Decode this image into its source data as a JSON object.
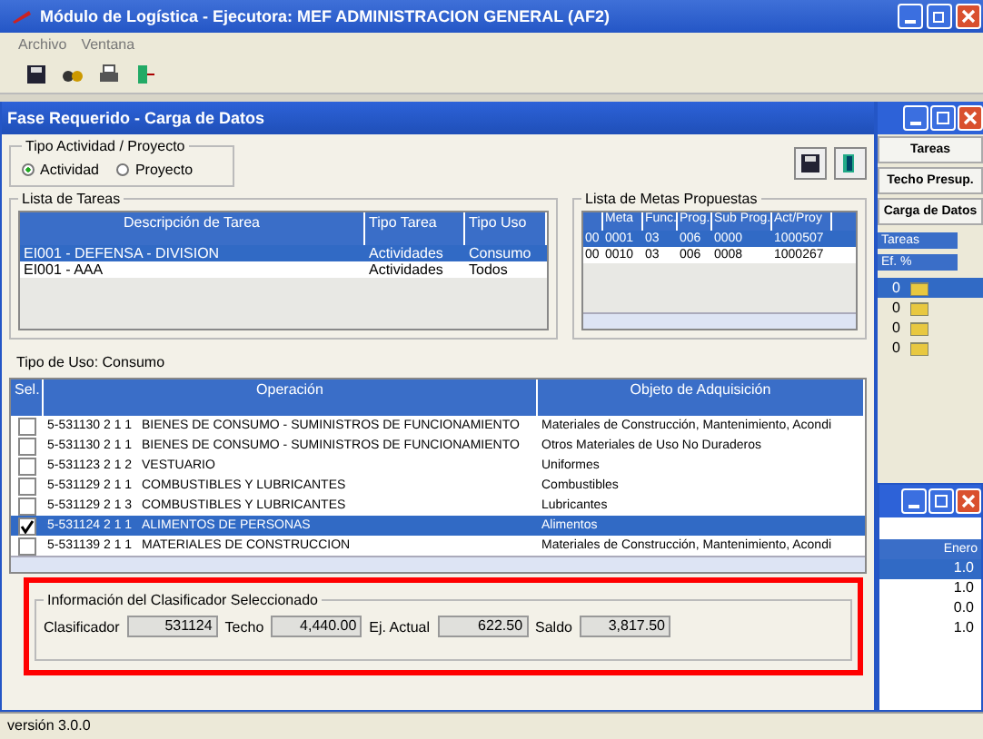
{
  "window": {
    "title": "Módulo de Logística - Ejecutora: MEF ADMINISTRACION GENERAL (AF2)"
  },
  "menu": [
    "Archivo",
    "Ventana"
  ],
  "dialog": {
    "title": "Fase Requerido - Carga de Datos",
    "tipo_group": {
      "title": "Tipo Actividad / Proyecto",
      "options": [
        {
          "label": "Actividad",
          "selected": true
        },
        {
          "label": "Proyecto",
          "selected": false
        }
      ]
    },
    "tareas": {
      "title": "Lista de Tareas",
      "columns": [
        "Descripción de Tarea",
        "Tipo Tarea",
        "Tipo Uso"
      ],
      "rows": [
        {
          "cells": [
            "EI001 - DEFENSA - DIVISION",
            "Actividades",
            "Consumo"
          ],
          "selected": true
        },
        {
          "cells": [
            "EI001 - AAA",
            "Actividades",
            "Todos"
          ],
          "selected": false
        }
      ]
    },
    "metas": {
      "title": "Lista de Metas Propuestas",
      "columns": [
        "",
        "Meta",
        "Func.",
        "Prog.",
        "Sub Prog.",
        "Act/Proy"
      ],
      "rows": [
        {
          "cells": [
            "00",
            "0001",
            "03",
            "006",
            "0000",
            "1000507"
          ],
          "selected": true
        },
        {
          "cells": [
            "00",
            "0010",
            "03",
            "006",
            "0008",
            "1000267"
          ],
          "selected": false
        }
      ]
    },
    "tipo_uso": "Tipo de Uso: Consumo",
    "operaciones": {
      "columns": [
        "Sel.",
        "Operación",
        "Objeto de Adquisición"
      ],
      "rows": [
        {
          "code": "5-531130 2 1 1",
          "operation": "BIENES DE CONSUMO - SUMINISTROS DE FUNCIONAMIENTO",
          "object": "Materiales de Construcción, Mantenimiento, Acondi",
          "checked": false,
          "selected": false
        },
        {
          "code": "5-531130 2 1 1",
          "operation": "BIENES DE CONSUMO - SUMINISTROS DE FUNCIONAMIENTO",
          "object": "Otros Materiales de Uso No Duraderos",
          "checked": false,
          "selected": false
        },
        {
          "code": "5-531123 2 1 2",
          "operation": "VESTUARIO",
          "object": "Uniformes",
          "checked": false,
          "selected": false
        },
        {
          "code": "5-531129 2 1 1",
          "operation": "COMBUSTIBLES Y LUBRICANTES",
          "object": "Combustibles",
          "checked": false,
          "selected": false
        },
        {
          "code": "5-531129 2 1 3",
          "operation": "COMBUSTIBLES Y LUBRICANTES",
          "object": "Lubricantes",
          "checked": false,
          "selected": false
        },
        {
          "code": "5-531124 2 1 1",
          "operation": "ALIMENTOS DE PERSONAS",
          "object": "Alimentos",
          "checked": true,
          "selected": true
        },
        {
          "code": "5-531139 2 1 1",
          "operation": "MATERIALES DE CONSTRUCCION",
          "object": "Materiales de Construcción, Mantenimiento, Acondi",
          "checked": false,
          "selected": false
        }
      ]
    },
    "info": {
      "title": "Información del Clasificador Seleccionado",
      "fields": [
        {
          "label": "Clasificador",
          "value": "531124"
        },
        {
          "label": "Techo",
          "value": "4,440.00"
        },
        {
          "label": "Ej. Actual",
          "value": "622.50"
        },
        {
          "label": "Saldo",
          "value": "3,817.50"
        }
      ]
    }
  },
  "back_window": {
    "buttons": [
      "Tareas",
      "Techo Presup.",
      "Carga de Datos"
    ],
    "headers": [
      "Tareas",
      "Ef. %"
    ],
    "rows": [
      {
        "value": "0",
        "selected": true
      },
      {
        "value": "0",
        "selected": false
      },
      {
        "value": "0",
        "selected": false
      },
      {
        "value": "0",
        "selected": false
      }
    ]
  },
  "second_window": {
    "header": "Enero",
    "rows": [
      {
        "value": "1.0",
        "selected": true
      },
      {
        "value": "1.0",
        "selected": false
      },
      {
        "value": "0.0",
        "selected": false
      },
      {
        "value": "1.0",
        "selected": false
      }
    ]
  },
  "status_bar": "versión 3.0.0"
}
